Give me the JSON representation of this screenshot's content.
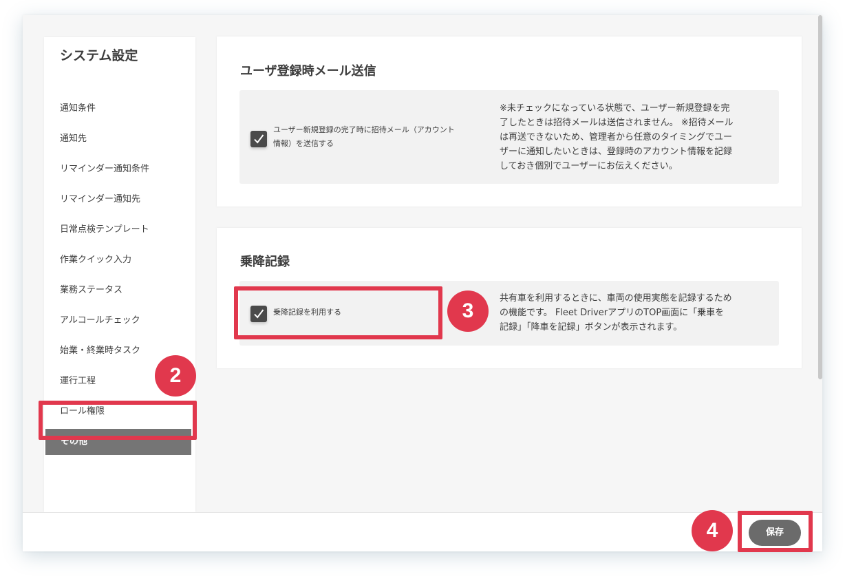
{
  "sidebar": {
    "title": "システム設定",
    "items": [
      {
        "label": "通知条件"
      },
      {
        "label": "通知先"
      },
      {
        "label": "リマインダー通知条件"
      },
      {
        "label": "リマインダー通知先"
      },
      {
        "label": "日常点検テンプレート"
      },
      {
        "label": "作業クイック入力"
      },
      {
        "label": "業務ステータス"
      },
      {
        "label": "アルコールチェック"
      },
      {
        "label": "始業・終業時タスク"
      },
      {
        "label": "運行工程"
      },
      {
        "label": "ロール権限"
      },
      {
        "label": "その他",
        "active": true
      }
    ]
  },
  "email_section": {
    "title": "ユーザ登録時メール送信",
    "checkbox_checked": true,
    "checkbox_label_line1": "ユーザー新規登録の完了時に招待メール（アカウント",
    "checkbox_label_line2": "情報）を送信する",
    "description_lines": [
      "※未チェックになっている状態で、ユーザー新規登録を完",
      "了したときは招待メールは送信されません。 ※招待メール",
      "は再送できないため、管理者から任意のタイミングでユー",
      "ザーに通知したいときは、登録時のアカウント情報を記録",
      "しておき個別でユーザーにお伝えください。"
    ]
  },
  "ride_section": {
    "title": "乗降記録",
    "checkbox_checked": true,
    "checkbox_label": "乗降記録を利用する",
    "description_lines": [
      "共有車を利用するときに、車両の使用実態を記録するため",
      "の機能です。 Fleet DriverアプリのTOP画面に「乗車を",
      "記録」「降車を記録」ボタンが表示されます。"
    ]
  },
  "footer": {
    "save_label": "保存"
  },
  "annotations": {
    "badge_2": "2",
    "badge_3": "3",
    "badge_4": "4",
    "highlight_color": "#e1384d"
  }
}
